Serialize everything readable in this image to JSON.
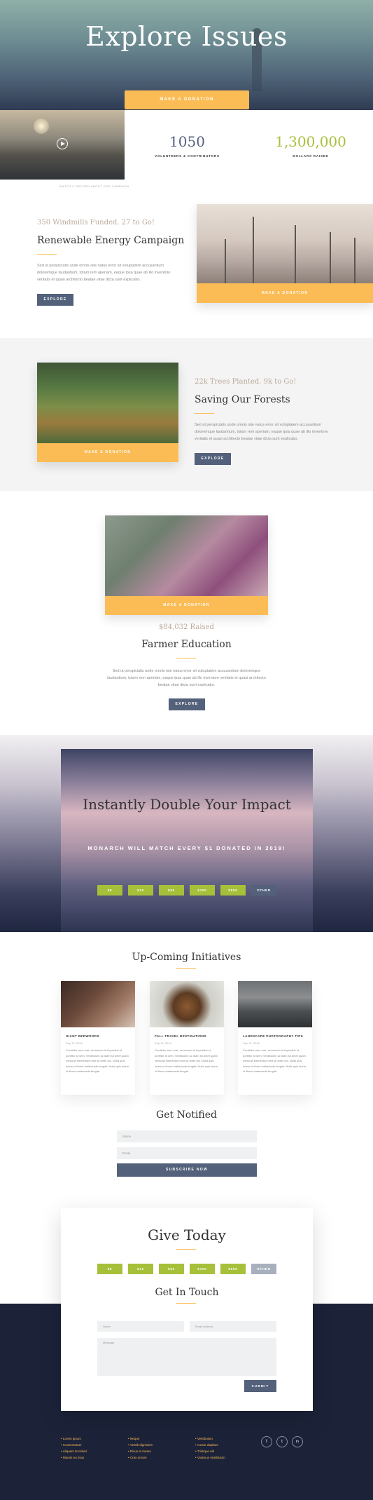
{
  "hero": {
    "title": "Explore Issues",
    "donate_label": "MAKE A DONATION"
  },
  "video": {
    "caption": "WATCH & RECORD ABOUT OUR CAMPAIGN"
  },
  "stats": [
    {
      "value": "1050",
      "label": "VOLUNTEERS & CONTRIBUTORS",
      "color": "#54617b"
    },
    {
      "value": "1,300,000",
      "label": "DOLLARS RAISED",
      "color": "#a7c03a"
    }
  ],
  "campaigns": {
    "energy": {
      "kicker": "350 Windmills Funded. 27 to Go!",
      "title": "Renewable Energy Campaign",
      "text": "Sed ut perspiciatis unde omnis iste natus error sit voluptatem accusantium doloremque laudantium, totam rem aperiam, eaque ipsa quae ab illo inventore veritatis et quasi architecto beatae vitae dicta sunt explicabo.",
      "button": "EXPLORE",
      "donate_label": "MAKE A DONATION"
    },
    "forests": {
      "kicker": "22k Trees Planted. 9k to Go!",
      "title": "Saving Our Forests",
      "text": "Sed ut perspiciatis unde omnis iste natus error sit voluptatem accusantium doloremque laudantium, totam rem aperiam, eaque ipsa quae ab illo inventore veritatis et quasi architecto beatae vitae dicta sunt explicabo.",
      "button": "EXPLORE",
      "donate_label": "MAKE A DONATION"
    },
    "farmer": {
      "kicker": "$84,032 Raised",
      "title": "Farmer Education",
      "text": "Sed ut perspiciatis unde omnis iste natus error sit voluptatem accusantium doloremque laudantium, totam rem aperiam, eaque ipsa quae ab illo inventore veritatis et quasi architecto beatae vitae dicta sunt explicabo.",
      "button": "EXPLORE",
      "donate_label": "MAKE A DONATION"
    }
  },
  "impact": {
    "title": "Instantly Double Your Impact",
    "subtitle": "MONARCH WILL MATCH EVERY $1 DONATED IN 2019!",
    "amounts": [
      "$5",
      "$10",
      "$50",
      "$100",
      "$500",
      "OTHER"
    ]
  },
  "initiatives": {
    "title": "Up-Coming Initiatives",
    "items": [
      {
        "title": "GIANT REDWOODS",
        "date": "Sep 12, 2019",
        "text": "Curabitur arcu erat, accumsan id imperdiet et, porttitor at sem. Vestibulum ac diam sit amet quam vehicula elementum sed sit amet dui. Nulla quis lorem ut libero malesuada feugiat. Nulla quis lorem ut libero malesuada feugiat."
      },
      {
        "title": "FALL TRAVEL DESTINATIONS",
        "date": "Sep 12, 2019",
        "text": "Curabitur arcu erat, accumsan id imperdiet et, porttitor at sem. Vestibulum ac diam sit amet quam vehicula elementum sed sit amet dui. Nulla quis lorem ut libero malesuada feugiat. Nulla quis lorem ut libero malesuada feugiat."
      },
      {
        "title": "LANDSCAPE PHOTOGRAPHY TIPS",
        "date": "Sep 12, 2019",
        "text": "Curabitur arcu erat, accumsan id imperdiet et, porttitor at sem. Vestibulum ac diam sit amet quam vehicula elementum sed sit amet dui. Nulla quis lorem ut libero malesuada feugiat. Nulla quis lorem ut libero malesuada feugiat."
      }
    ]
  },
  "notify": {
    "title": "Get Notified",
    "name_placeholder": "Name",
    "email_placeholder": "Email",
    "button": "SUBSCRIBE NOW"
  },
  "give": {
    "title": "Give Today",
    "amounts": [
      "$5",
      "$10",
      "$50",
      "$100",
      "$500",
      "OTHER"
    ]
  },
  "contact": {
    "title": "Get In Touch",
    "name_placeholder": "Name",
    "email_placeholder": "Email Address",
    "message_placeholder": "Message",
    "button": "SUBMIT"
  },
  "footer": {
    "col1": [
      "Lorem ipsum",
      "Consectetuer",
      "Aliquam tincidunt",
      "Mauris eu risus"
    ],
    "col2": [
      "Neque",
      "Vestib dignissim",
      "Risus et metus",
      "Cras ornare"
    ],
    "col3": [
      "Vestibulum",
      "Auctor dapibus",
      "Tristique elit",
      "Vivamus vestibulum"
    ],
    "social": [
      "f",
      "t",
      "in"
    ]
  }
}
